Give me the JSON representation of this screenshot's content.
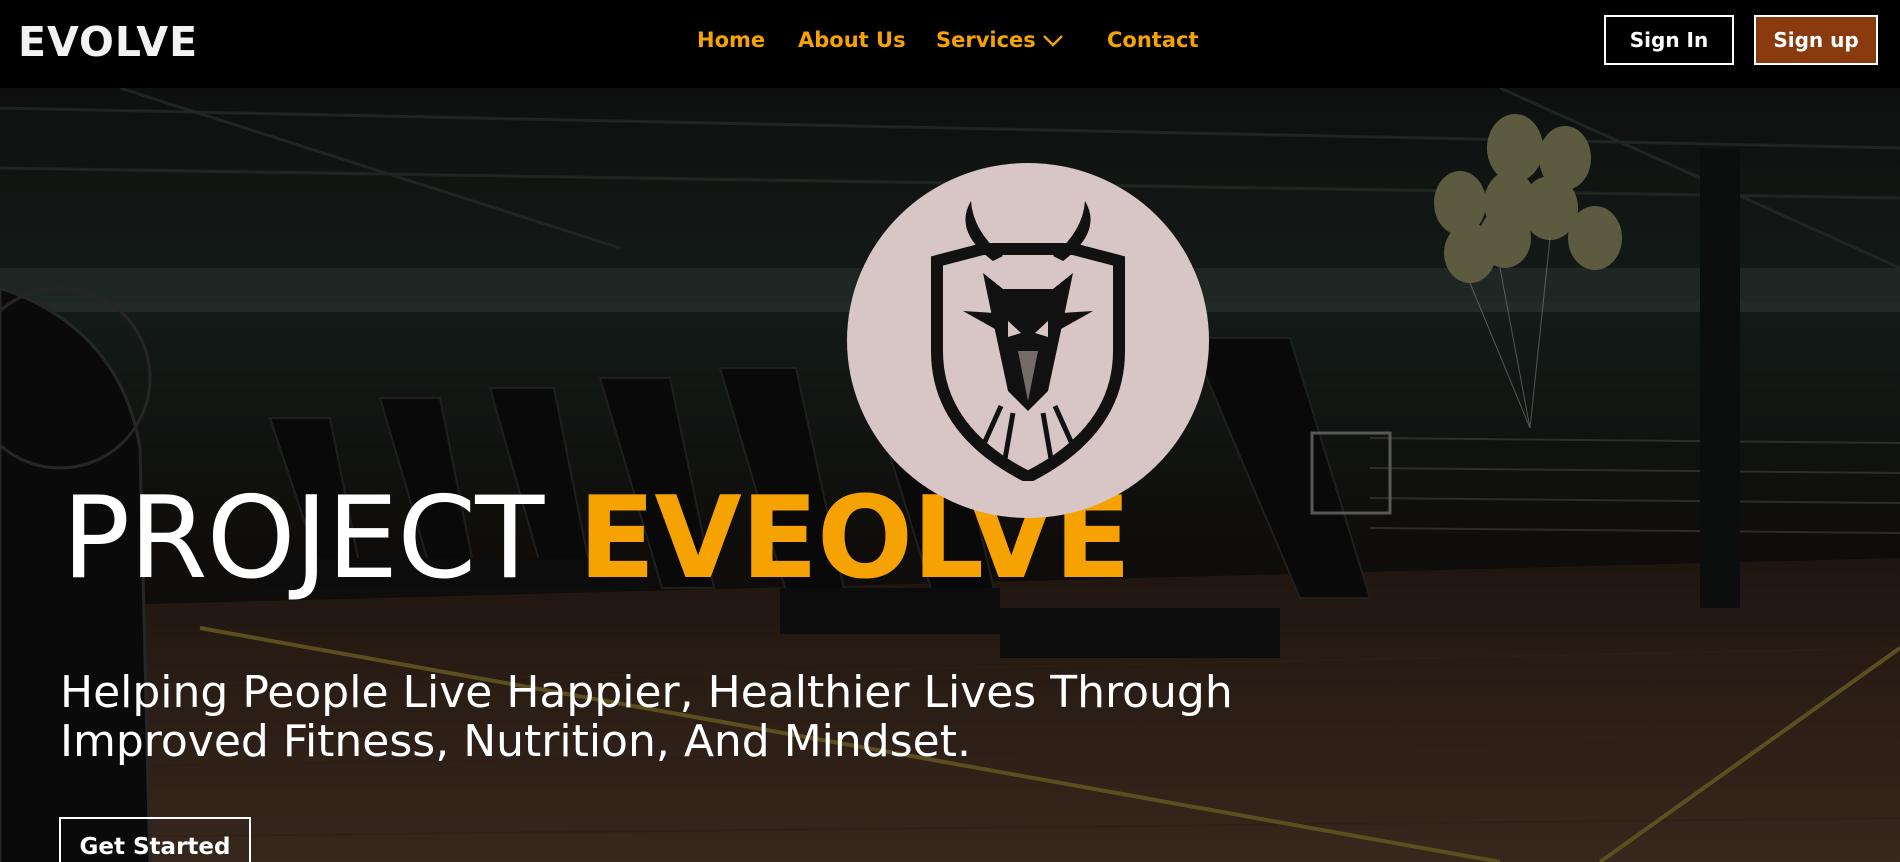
{
  "header": {
    "brand": "EVOLVE",
    "nav": [
      {
        "label": "Home"
      },
      {
        "label": "About Us"
      },
      {
        "label": "Services",
        "icon": "chevron-down-icon"
      },
      {
        "label": "Contact"
      }
    ],
    "signin_label": "Sign In",
    "signup_label": "Sign up"
  },
  "hero": {
    "title_light": "PROJECT",
    "title_bold": "EVEOLVE",
    "subtitle_line1": "Helping People Live Happier, Healthier Lives Through",
    "subtitle_line2": "Improved Fitness, Nutrition, And Mindset.",
    "cta_label": "Get Started",
    "logo_icon": "deer-shield-logo-icon",
    "background": "gym-interior-photo"
  },
  "colors": {
    "accent": "#f5a202",
    "header_bg": "#000000",
    "signup_bg": "#8a3a0f",
    "logo_circle": "#d8c6c6"
  }
}
